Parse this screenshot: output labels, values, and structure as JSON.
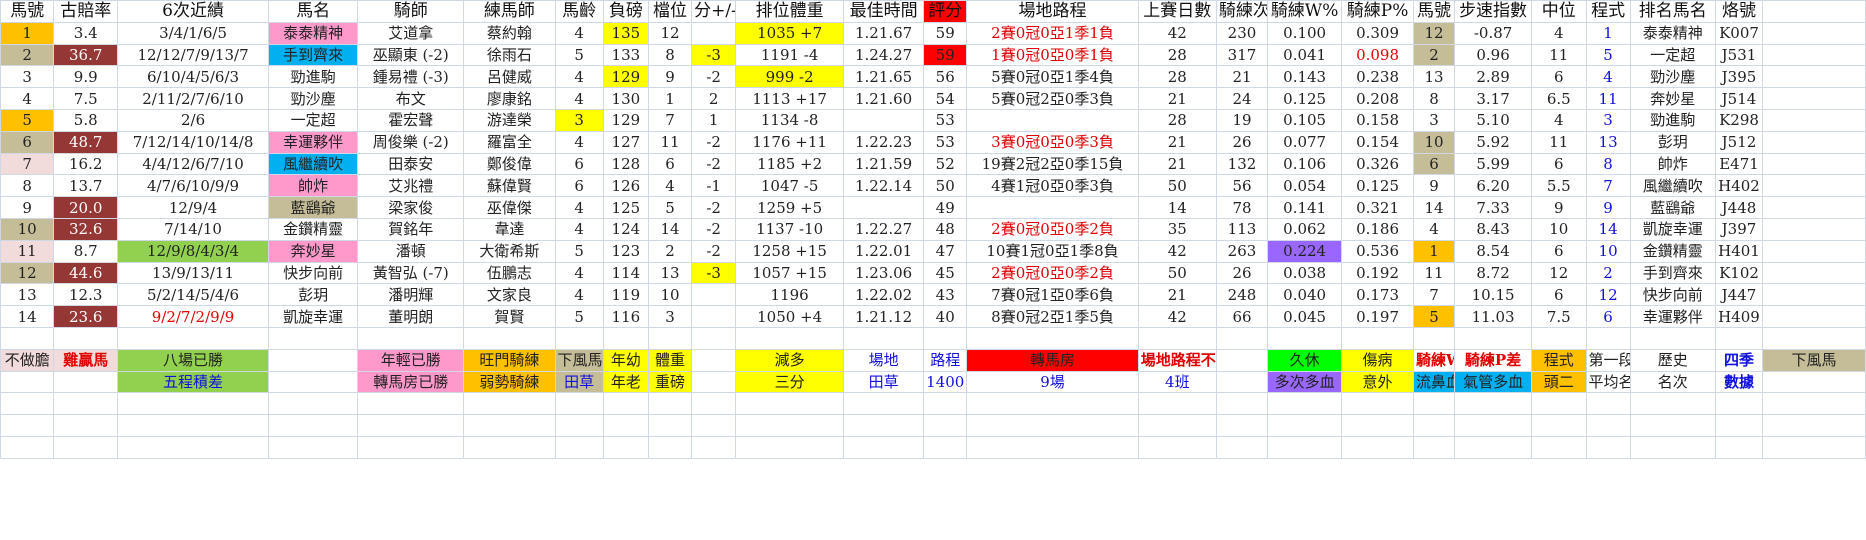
{
  "colors": {
    "orange": "#ffc000",
    "tan": "#c4bd97",
    "pink": "#f2dcdb",
    "maroon": "#953735",
    "wine": "#963634",
    "yellow": "#ffff00",
    "cyan": "#00b0f0",
    "rose": "#ff99cc",
    "green": "#92d050",
    "lime": "#00ff00",
    "red": "#ff0000",
    "purple": "#9966ff",
    "text_red": "#e00000",
    "text_blue": "#1010e0"
  },
  "headers": [
    "馬號",
    "古賠率",
    "6次近績",
    "馬名",
    "騎師",
    "練馬師",
    "馬齡",
    "負磅",
    "檔位",
    "分+/-",
    "排位體重",
    "最佳時間",
    "評分",
    "場地路程",
    "上賽日數",
    "騎練次",
    "騎練W%",
    "騎練P%",
    "馬號",
    "步速指數",
    "中位",
    "程式",
    "排名馬名",
    "烙號"
  ],
  "rows": [
    [
      "1",
      "3.4",
      "3/4/1/6/5",
      "泰泰精神",
      "艾道拿",
      "蔡約翰",
      "4",
      "135",
      "12",
      "",
      "1035 +7",
      "1.21.67",
      "59",
      "2賽0冠0亞1季1負",
      "42",
      "230",
      "0.100",
      "0.309",
      "12",
      "-0.87",
      "4",
      "1",
      "泰泰精神",
      "K007"
    ],
    [
      "2",
      "36.7",
      "12/12/7/9/13/7",
      "手到齊來",
      "巫顯東 (-2)",
      "徐雨石",
      "5",
      "133",
      "8",
      "-3",
      "1191 -4",
      "1.24.27",
      "59",
      "1賽0冠0亞0季1負",
      "28",
      "317",
      "0.041",
      "0.098",
      "2",
      "0.96",
      "11",
      "5",
      "一定超",
      "J531"
    ],
    [
      "3",
      "9.9",
      "6/10/4/5/6/3",
      "勁進駒",
      "鍾易禮 (-3)",
      "呂健威",
      "4",
      "129",
      "9",
      "-2",
      "999 -2",
      "1.21.65",
      "56",
      "5賽0冠0亞1季4負",
      "28",
      "21",
      "0.143",
      "0.238",
      "13",
      "2.89",
      "6",
      "4",
      "勁沙塵",
      "J395"
    ],
    [
      "4",
      "7.5",
      "2/11/2/7/6/10",
      "勁沙塵",
      "布文",
      "廖康銘",
      "4",
      "130",
      "1",
      "2",
      "1113 +17",
      "1.21.60",
      "54",
      "5賽0冠2亞0季3負",
      "21",
      "24",
      "0.125",
      "0.208",
      "8",
      "3.17",
      "6.5",
      "11",
      "奔妙星",
      "J514"
    ],
    [
      "5",
      "5.8",
      "2/6",
      "一定超",
      "霍宏聲",
      "游達榮",
      "3",
      "129",
      "7",
      "1",
      "1134 -8",
      "",
      "53",
      "",
      "28",
      "19",
      "0.105",
      "0.158",
      "3",
      "5.10",
      "4",
      "3",
      "勁進駒",
      "K298"
    ],
    [
      "6",
      "48.7",
      "7/12/14/10/14/8",
      "幸運夥伴",
      "周俊樂 (-2)",
      "羅富全",
      "4",
      "127",
      "11",
      "-2",
      "1176 +11",
      "1.22.23",
      "53",
      "3賽0冠0亞0季3負",
      "21",
      "26",
      "0.077",
      "0.154",
      "10",
      "5.92",
      "11",
      "13",
      "彭玥",
      "J512"
    ],
    [
      "7",
      "16.2",
      "4/4/12/6/7/10",
      "風繼續吹",
      "田泰安",
      "鄭俊偉",
      "6",
      "128",
      "6",
      "-2",
      "1185 +2",
      "1.21.59",
      "52",
      "19賽2冠2亞0季15負",
      "21",
      "132",
      "0.106",
      "0.326",
      "6",
      "5.99",
      "6",
      "8",
      "帥炸",
      "E471"
    ],
    [
      "8",
      "13.7",
      "4/7/6/10/9/9",
      "帥炸",
      "艾兆禮",
      "蘇偉賢",
      "6",
      "126",
      "4",
      "-1",
      "1047 -5",
      "1.22.14",
      "50",
      "4賽1冠0亞0季3負",
      "50",
      "56",
      "0.054",
      "0.125",
      "9",
      "6.20",
      "5.5",
      "7",
      "風繼續吹",
      "H402"
    ],
    [
      "9",
      "20.0",
      "12/9/4",
      "藍鷂爺",
      "梁家俊",
      "巫偉傑",
      "4",
      "125",
      "5",
      "-2",
      "1259 +5",
      "",
      "49",
      "",
      "14",
      "78",
      "0.141",
      "0.321",
      "14",
      "7.33",
      "9",
      "9",
      "藍鷂爺",
      "J448"
    ],
    [
      "10",
      "32.6",
      "7/14/10",
      "金鑽精靈",
      "賀銘年",
      "韋達",
      "4",
      "124",
      "14",
      "-2",
      "1137 -10",
      "1.22.27",
      "48",
      "2賽0冠0亞0季2負",
      "35",
      "113",
      "0.062",
      "0.186",
      "4",
      "8.43",
      "10",
      "14",
      "凱旋幸運",
      "J397"
    ],
    [
      "11",
      "8.7",
      "12/9/8/4/3/4",
      "奔妙星",
      "潘頓",
      "大衛希斯",
      "5",
      "123",
      "2",
      "-2",
      "1258 +15",
      "1.22.01",
      "47",
      "10賽1冠0亞1季8負",
      "42",
      "263",
      "0.224",
      "0.536",
      "1",
      "8.54",
      "6",
      "10",
      "金鑽精靈",
      "H401"
    ],
    [
      "12",
      "44.6",
      "13/9/13/11",
      "快步向前",
      "黃智弘 (-7)",
      "伍鵬志",
      "4",
      "114",
      "13",
      "-3",
      "1057 +15",
      "1.23.06",
      "45",
      "2賽0冠0亞0季2負",
      "50",
      "26",
      "0.038",
      "0.192",
      "11",
      "8.72",
      "12",
      "2",
      "手到齊來",
      "K102"
    ],
    [
      "13",
      "12.3",
      "5/2/14/5/4/6",
      "彭玥",
      "潘明輝",
      "文家良",
      "4",
      "119",
      "10",
      "",
      "1196",
      "1.22.02",
      "43",
      "7賽0冠1亞0季6負",
      "21",
      "248",
      "0.040",
      "0.173",
      "7",
      "10.15",
      "6",
      "12",
      "快步向前",
      "J447"
    ],
    [
      "14",
      "23.6",
      "9/2/7/2/9/9",
      "凱旋幸運",
      "董明朗",
      "賀賢",
      "5",
      "116",
      "3",
      "",
      "1050 +4",
      "1.21.12",
      "40",
      "8賽0冠2亞1季5負",
      "42",
      "66",
      "0.045",
      "0.197",
      "5",
      "11.03",
      "7.5",
      "6",
      "幸運夥伴",
      "H409"
    ]
  ],
  "legend": {
    "row1": [
      "不做膽",
      "雞贏馬",
      "八場已勝",
      "",
      "年輕已勝",
      "旺門騎練",
      "下風馬",
      "年幼",
      "體重",
      "",
      "減多",
      "場地",
      "路程",
      "轉馬房",
      "場地路程不佳",
      "",
      "久休",
      "傷病",
      "騎練W差",
      "騎練P差",
      "程式",
      "第一段",
      "歷史",
      "四季",
      "下風馬"
    ],
    "row2": [
      "",
      "",
      "五程積差",
      "",
      "轉馬房已勝",
      "弱勢騎練",
      "田草",
      "年老",
      "重磅",
      "",
      "三分",
      "田草",
      "1400",
      "9場",
      "4班",
      "",
      "多次多血",
      "意外",
      "流鼻血",
      "氣管多血",
      "頭二",
      "平均名次",
      "名次",
      "數據",
      ""
    ]
  }
}
